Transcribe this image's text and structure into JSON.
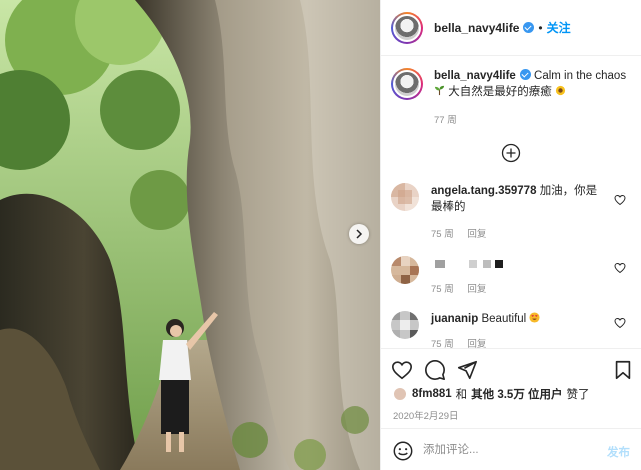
{
  "post": {
    "username": "bella_navy4life",
    "follow_label": "关注",
    "dot": "•"
  },
  "caption": {
    "username": "bella_navy4life",
    "text_en": "Calm in the chaos",
    "text_zh": "大自然是最好的療癒",
    "time": "77 周"
  },
  "comments": [
    {
      "username": "angela.tang.359778",
      "text": "加油，你是最棒的",
      "time": "75 周",
      "reply": "回复"
    },
    {
      "username": "",
      "text": "",
      "time": "75 周",
      "reply": "回复"
    },
    {
      "username": "juananip",
      "text": "Beautiful",
      "time": "75 周",
      "reply": "回复"
    }
  ],
  "likes": {
    "user": "8fm881",
    "and": "和",
    "others": "其他 3.5万 位用户",
    "suffix": "赞了"
  },
  "date": "2020年2月29日",
  "composer": {
    "placeholder": "添加评论...",
    "post_label": "发布"
  },
  "colors": {
    "accent": "#0095f6",
    "muted": "#8e8e8e",
    "post_disabled": "#b2dffc"
  }
}
